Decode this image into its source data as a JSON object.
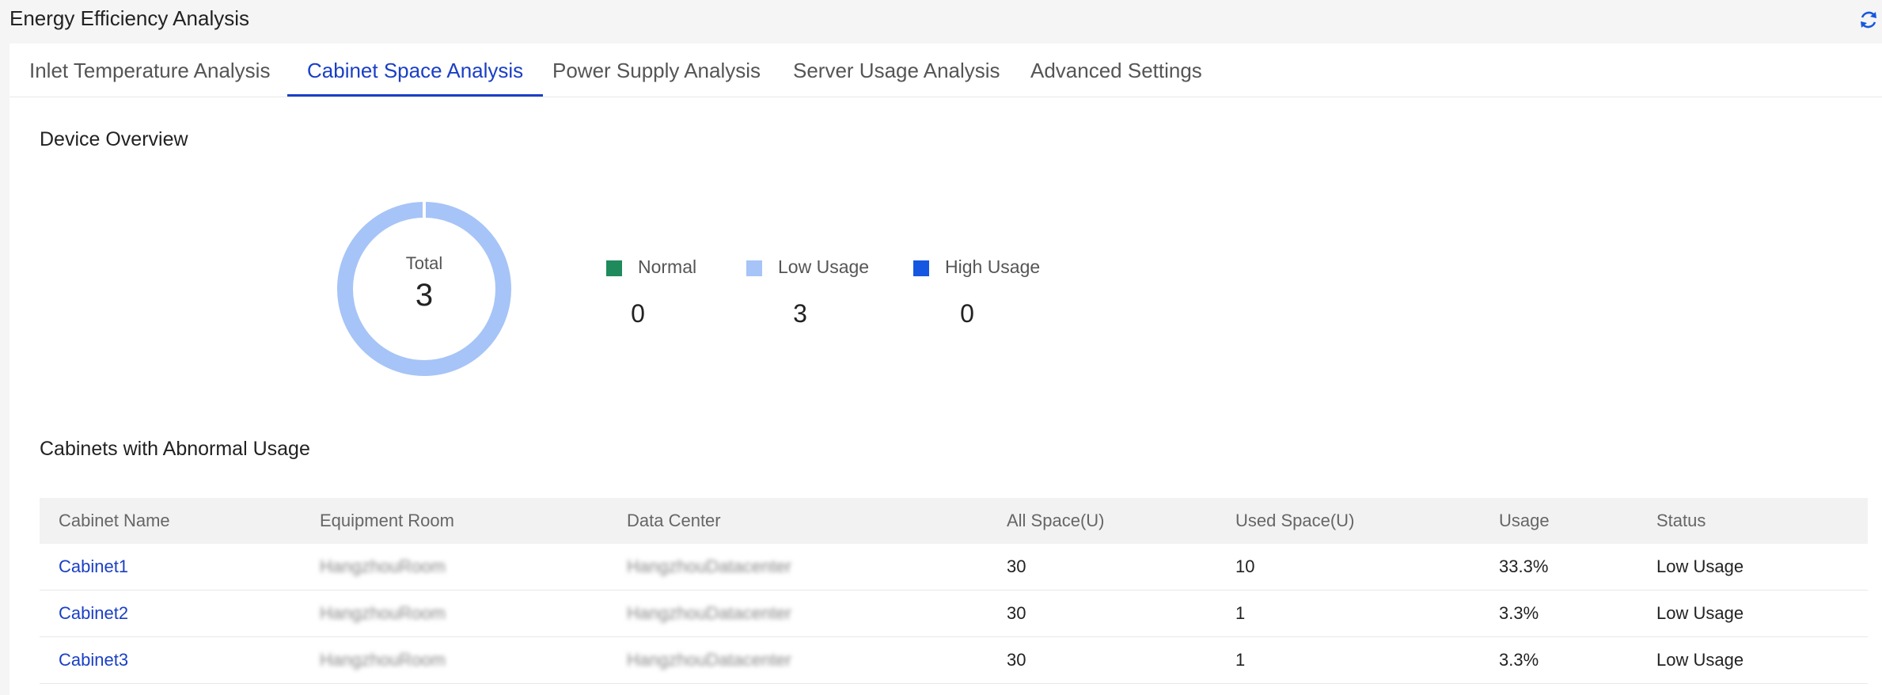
{
  "header": {
    "title": "Energy Efficiency Analysis",
    "refresh_icon": "refresh-icon"
  },
  "tabs": [
    {
      "label": "Inlet Temperature Analysis",
      "active": false
    },
    {
      "label": "Cabinet Space Analysis",
      "active": true
    },
    {
      "label": "Power Supply Analysis",
      "active": false
    },
    {
      "label": "Server Usage Analysis",
      "active": false
    },
    {
      "label": "Advanced Settings",
      "active": false
    }
  ],
  "overview": {
    "title": "Device Overview",
    "total_label": "Total",
    "total_value": "3",
    "legend": [
      {
        "label": "Normal",
        "value": "0",
        "color": "#1f8a5b"
      },
      {
        "label": "Low Usage",
        "value": "3",
        "color": "#a6c4f7"
      },
      {
        "label": "High Usage",
        "value": "0",
        "color": "#1557e0"
      }
    ]
  },
  "abnormal": {
    "title": "Cabinets with Abnormal Usage",
    "columns": [
      "Cabinet Name",
      "Equipment Room",
      "Data Center",
      "All Space(U)",
      "Used Space(U)",
      "Usage",
      "Status"
    ],
    "rows": [
      [
        "Cabinet1",
        "HangzhouRoom",
        "HangzhouDatacenter",
        "30",
        "10",
        "33.3%",
        "Low Usage"
      ],
      [
        "Cabinet2",
        "HangzhouRoom",
        "HangzhouDatacenter",
        "30",
        "1",
        "3.3%",
        "Low Usage"
      ],
      [
        "Cabinet3",
        "HangzhouRoom",
        "HangzhouDatacenter",
        "30",
        "1",
        "3.3%",
        "Low Usage"
      ]
    ]
  },
  "colors": {
    "accent": "#1a3fc6",
    "donut_low_usage": "#a6c4f7"
  }
}
